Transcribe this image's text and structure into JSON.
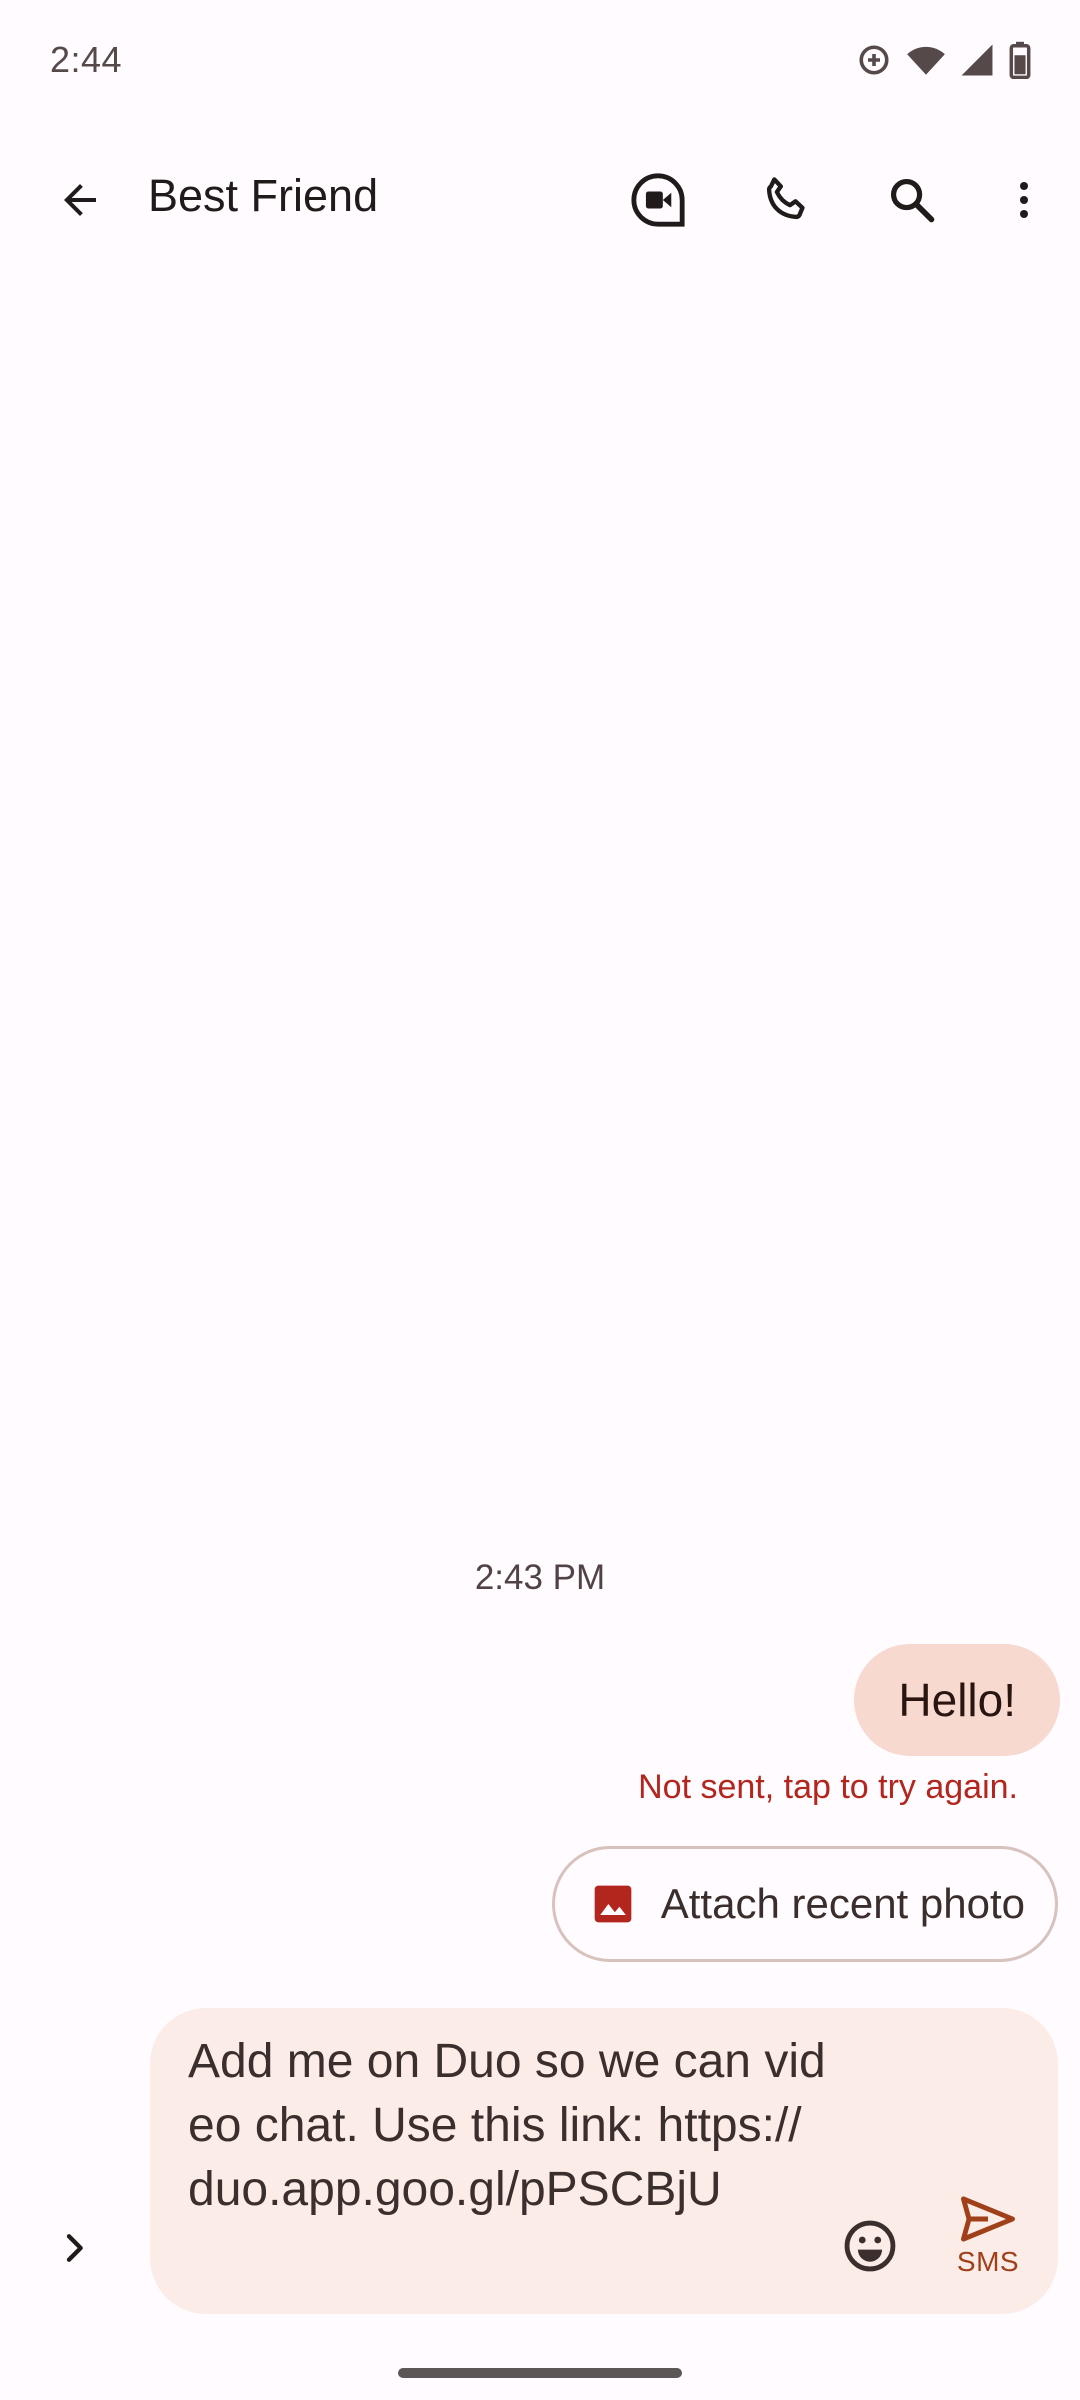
{
  "status_bar": {
    "time": "2:44",
    "icons": [
      "data-saver-icon",
      "wifi-icon",
      "signal-icon",
      "battery-icon"
    ]
  },
  "app_bar": {
    "title": "Best Friend",
    "icons": [
      "back-arrow-icon",
      "video-call-icon",
      "phone-icon",
      "search-icon",
      "more-vert-icon"
    ]
  },
  "conversation": {
    "timestamp": "2:43 PM",
    "messages": [
      {
        "text": "Hello!",
        "status": "Not sent, tap to try again."
      }
    ],
    "suggestion_chip": {
      "label": "Attach recent photo",
      "icon": "image-icon"
    }
  },
  "composer": {
    "text": "Add me on Duo so we can video chat. Use this link: https://duo.app.goo.gl/pPSCBjU",
    "send_label": "SMS",
    "icons": [
      "expand-icon",
      "emoji-icon",
      "send-icon"
    ]
  },
  "colors": {
    "background": "#FFFBFE",
    "bubble": "#F8D9CF",
    "error": "#B3261E",
    "compose_bg": "#FBECE7",
    "accent": "#A0401A"
  }
}
